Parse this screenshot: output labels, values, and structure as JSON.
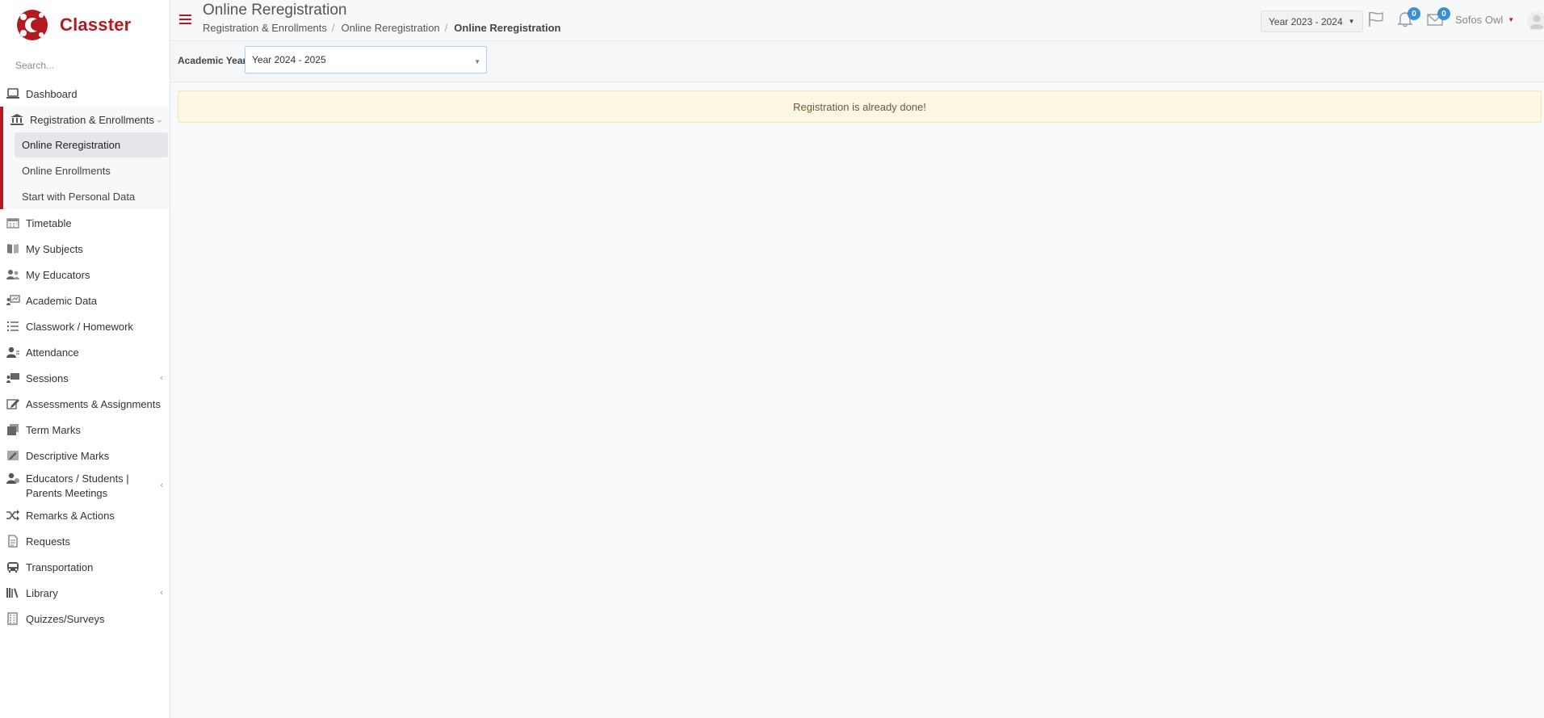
{
  "app": {
    "name": "Classter",
    "brand_color": "#b31b23"
  },
  "search": {
    "placeholder": "Search..."
  },
  "sidebar": {
    "items": [
      {
        "label": "Dashboard",
        "icon": "laptop-icon"
      },
      {
        "label": "Registration & Enrollments",
        "icon": "bank-icon",
        "expanded": true,
        "children": [
          {
            "label": "Online Reregistration",
            "active": true
          },
          {
            "label": "Online Enrollments"
          },
          {
            "label": "Start with Personal Data"
          }
        ]
      },
      {
        "label": "Timetable",
        "icon": "calendar-icon"
      },
      {
        "label": "My Subjects",
        "icon": "book-icon"
      },
      {
        "label": "My Educators",
        "icon": "users-icon"
      },
      {
        "label": "Academic Data",
        "icon": "presentation-icon"
      },
      {
        "label": "Classwork / Homework",
        "icon": "list-icon"
      },
      {
        "label": "Attendance",
        "icon": "user-check-icon"
      },
      {
        "label": "Sessions",
        "icon": "sessions-icon",
        "has_submenu": true
      },
      {
        "label": "Assessments & Assignments",
        "icon": "edit-icon"
      },
      {
        "label": "Term Marks",
        "icon": "marks-icon"
      },
      {
        "label": "Descriptive Marks",
        "icon": "descriptive-marks-icon"
      },
      {
        "label": "Educators / Students | Parents Meetings",
        "icon": "meeting-icon",
        "has_submenu": true
      },
      {
        "label": "Remarks & Actions",
        "icon": "shuffle-icon"
      },
      {
        "label": "Requests",
        "icon": "document-icon"
      },
      {
        "label": "Transportation",
        "icon": "bus-icon"
      },
      {
        "label": "Library",
        "icon": "library-icon",
        "has_submenu": true
      },
      {
        "label": "Quizzes/Surveys",
        "icon": "quiz-icon"
      }
    ]
  },
  "header": {
    "title": "Online Reregistration",
    "breadcrumbs": [
      "Registration & Enrollments",
      "Online Reregistration",
      "Online Reregistration"
    ],
    "year_selector": "Year 2023 - 2024",
    "notifications_count": "0",
    "messages_count": "0",
    "user_name": "Sofos Owl"
  },
  "filter": {
    "label": "Academic Year",
    "selected": "Year 2024 - 2025"
  },
  "alert": {
    "message": "Registration is already done!"
  }
}
